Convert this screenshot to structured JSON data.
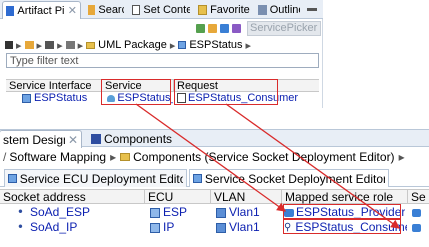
{
  "top_panel": {
    "tabs": [
      {
        "label": "Artifact Pi..."
      },
      {
        "label": "Search"
      },
      {
        "label": "Set Conte..."
      },
      {
        "label": "Favorites"
      },
      {
        "label": "Outline"
      }
    ],
    "service_picker_label": "ServicePicker",
    "breadcrumb": [
      "UML Package",
      "ESPStatus"
    ],
    "filter_placeholder": "Type filter text",
    "table": {
      "headers": [
        "Service Interface",
        "Service",
        "Request"
      ],
      "row": {
        "interface": "ESPStatus",
        "service": "ESPStatus_P",
        "request": "ESPStatus_Consumer"
      }
    }
  },
  "bottom_panel": {
    "tabs": [
      {
        "label": "stem Design"
      },
      {
        "label": "Components"
      }
    ],
    "breadcrumb": [
      "Software Mapping",
      "Components (Service Socket Deployment Editor)"
    ],
    "editor_tabs": [
      "Service ECU Deployment Editor",
      "Service Socket Deployment Editor"
    ],
    "table": {
      "headers": [
        "Socket address",
        "ECU",
        "VLAN",
        "Mapped service role",
        "Se"
      ],
      "rows": [
        {
          "socket": "SoAd_ESP",
          "ecu": "ESP",
          "vlan": "Vlan1",
          "role": "ESPStatus_Provider"
        },
        {
          "socket": "SoAd_IP",
          "ecu": "IP",
          "vlan": "Vlan1",
          "role": "ESPStatus_Consumer"
        }
      ]
    }
  },
  "colors": {
    "highlight": "#d92b2b",
    "link_text": "#0b1fb0",
    "tab_bar": "#e8eef6"
  }
}
